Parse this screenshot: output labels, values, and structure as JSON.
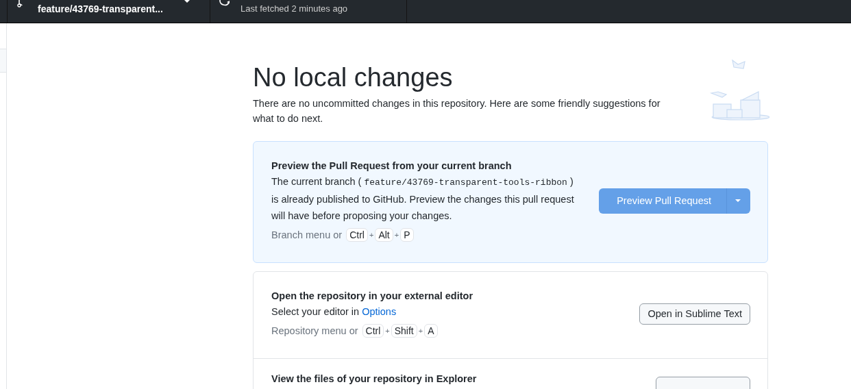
{
  "toolbar": {
    "branch": {
      "name": "feature/43769-transparent..."
    },
    "fetch": {
      "subtitle": "Last fetched 2 minutes ago"
    }
  },
  "blankslate": {
    "title": "No local changes",
    "description": "There are no uncommitted changes in this repository. Here are some friendly suggestions for what to do next."
  },
  "suggestions": [
    {
      "kind": "primary",
      "title": "Preview the Pull Request from your current branch",
      "description": {
        "before": "The current branch (",
        "code": "feature/43769-transparent-tools-ribbon",
        "after": ") is already published to GitHub. Preview the changes this pull request will have before proposing your changes."
      },
      "shortcut": {
        "label": "Branch menu or",
        "separator": "+",
        "keys": [
          "Ctrl",
          "Alt",
          "P"
        ]
      },
      "button": "Preview Pull Request"
    },
    {
      "kind": "normal",
      "title": "Open the repository in your external editor",
      "description": {
        "before": "Select your editor in",
        "link": "Options"
      },
      "shortcut": {
        "label": "Repository menu or",
        "separator": "+",
        "keys": [
          "Ctrl",
          "Shift",
          "A"
        ]
      },
      "button": "Open in Sublime Text"
    },
    {
      "kind": "normal",
      "title": "View the files of your repository in Explorer"
    }
  ]
}
